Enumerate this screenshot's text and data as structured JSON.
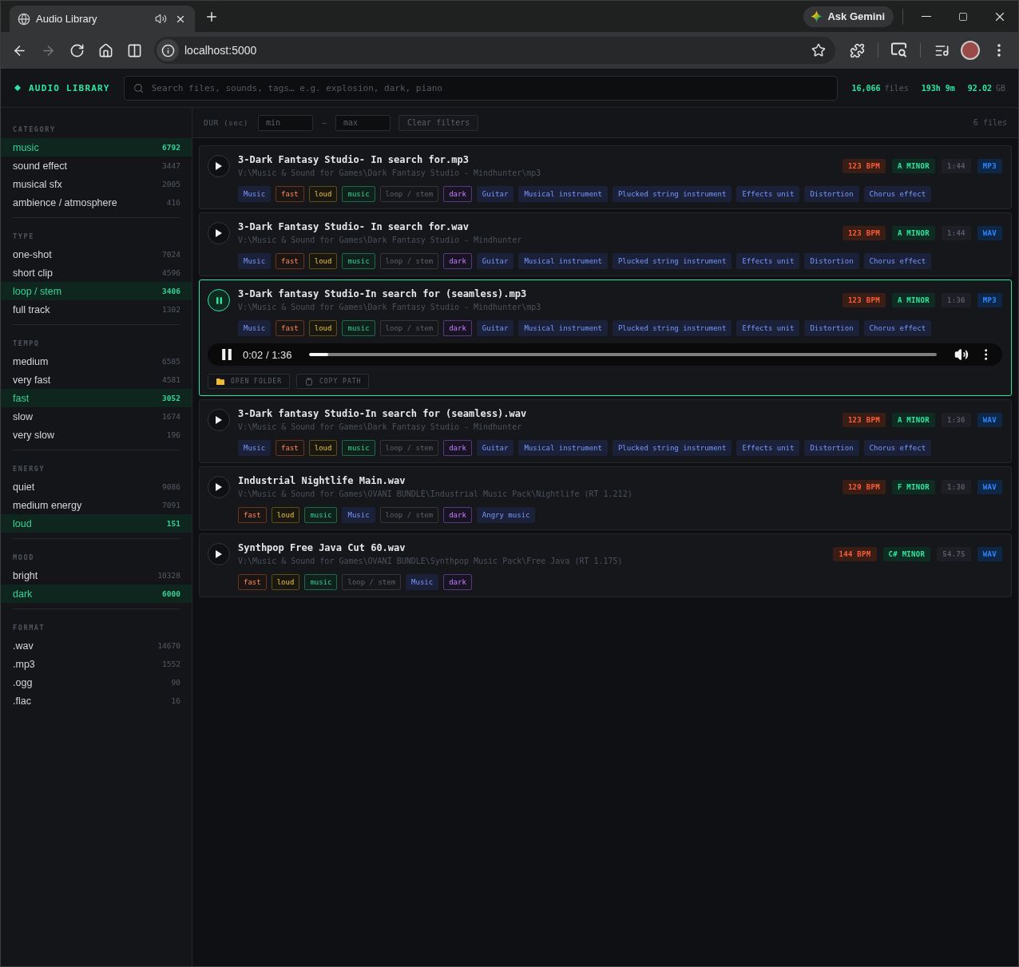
{
  "browser": {
    "tab_title": "Audio Library",
    "nav_buttons": [
      {
        "kind": "back",
        "disabled": false
      },
      {
        "kind": "forward",
        "disabled": true
      },
      {
        "kind": "reload",
        "disabled": false
      },
      {
        "kind": "home",
        "disabled": false
      },
      {
        "kind": "split",
        "disabled": false
      }
    ],
    "url": "localhost:5000",
    "gemini_button": "Ask Gemini"
  },
  "header": {
    "logo": "AUDIO LIBRARY",
    "search": {
      "placeholder": "Search files, sounds, tags… e.g. explosion, dark, piano"
    },
    "stats": [
      {
        "value": "16,066",
        "unit": "files"
      },
      {
        "value": "193h 9m"
      },
      {
        "value": "92.02",
        "unit": "GB"
      }
    ]
  },
  "filters": {
    "label": "DUR (sec)",
    "min": {
      "placeholder": "min"
    },
    "separator": "–",
    "max": {
      "placeholder": "max"
    },
    "clear_button": "Clear filters",
    "result_count": "6 files"
  },
  "sidebar": {
    "sections": [
      {
        "title": "CATEGORY",
        "items": [
          {
            "label": "music",
            "count": "6792",
            "selected": true
          },
          {
            "label": "sound effect",
            "count": "3447",
            "selected": false
          },
          {
            "label": "musical sfx",
            "count": "2005",
            "selected": false
          },
          {
            "label": "ambience / atmosphere",
            "count": "416",
            "selected": false
          }
        ]
      },
      {
        "title": "TYPE",
        "items": [
          {
            "label": "one-shot",
            "count": "7024",
            "selected": false
          },
          {
            "label": "short clip",
            "count": "4596",
            "selected": false
          },
          {
            "label": "loop / stem",
            "count": "3406",
            "selected": true
          },
          {
            "label": "full track",
            "count": "1302",
            "selected": false
          }
        ]
      },
      {
        "title": "TEMPO",
        "items": [
          {
            "label": "medium",
            "count": "6585",
            "selected": false
          },
          {
            "label": "very fast",
            "count": "4581",
            "selected": false
          },
          {
            "label": "fast",
            "count": "3052",
            "selected": true
          },
          {
            "label": "slow",
            "count": "1674",
            "selected": false
          },
          {
            "label": "very slow",
            "count": "196",
            "selected": false
          }
        ]
      },
      {
        "title": "ENERGY",
        "items": [
          {
            "label": "quiet",
            "count": "9086",
            "selected": false
          },
          {
            "label": "medium energy",
            "count": "7091",
            "selected": false
          },
          {
            "label": "loud",
            "count": "151",
            "selected": true
          }
        ]
      },
      {
        "title": "MOOD",
        "items": [
          {
            "label": "bright",
            "count": "10328",
            "selected": false
          },
          {
            "label": "dark",
            "count": "6000",
            "selected": true
          }
        ]
      },
      {
        "title": "FORMAT",
        "items": [
          {
            "label": ".wav",
            "count": "14670",
            "selected": false
          },
          {
            "label": ".mp3",
            "count": "1552",
            "selected": false
          },
          {
            "label": ".ogg",
            "count": "90",
            "selected": false
          },
          {
            "label": ".flac",
            "count": "16",
            "selected": false
          }
        ]
      }
    ]
  },
  "files": [
    {
      "title": "3-Dark Fantasy Studio- In search for.mp3",
      "path": "V:\\Music & Sound for Games\\Dark Fantasy Studio - Mindhunter\\mp3",
      "playing": false,
      "badges": [
        {
          "text": "123 BPM",
          "kind": "bpm"
        },
        {
          "text": "A MINOR",
          "kind": "key"
        },
        {
          "text": "1:44",
          "kind": "duration"
        },
        {
          "text": "MP3",
          "kind": "format"
        }
      ],
      "tags": [
        {
          "text": "Music",
          "kind": "label"
        },
        {
          "text": "fast",
          "kind": "tempo"
        },
        {
          "text": "loud",
          "kind": "energy"
        },
        {
          "text": "music",
          "kind": "category"
        },
        {
          "text": "loop / stem",
          "kind": "type"
        },
        {
          "text": "dark",
          "kind": "mood"
        },
        {
          "text": "Guitar",
          "kind": "label"
        },
        {
          "text": "Musical instrument",
          "kind": "label"
        },
        {
          "text": "Plucked string instrument",
          "kind": "label"
        },
        {
          "text": "Effects unit",
          "kind": "label"
        },
        {
          "text": "Distortion",
          "kind": "label"
        },
        {
          "text": "Chorus effect",
          "kind": "label"
        }
      ]
    },
    {
      "title": "3-Dark Fantasy Studio- In search for.wav",
      "path": "V:\\Music & Sound for Games\\Dark Fantasy Studio - Mindhunter",
      "playing": false,
      "badges": [
        {
          "text": "123 BPM",
          "kind": "bpm"
        },
        {
          "text": "A MINOR",
          "kind": "key"
        },
        {
          "text": "1:44",
          "kind": "duration"
        },
        {
          "text": "WAV",
          "kind": "format"
        }
      ],
      "tags": [
        {
          "text": "Music",
          "kind": "label"
        },
        {
          "text": "fast",
          "kind": "tempo"
        },
        {
          "text": "loud",
          "kind": "energy"
        },
        {
          "text": "music",
          "kind": "category"
        },
        {
          "text": "loop / stem",
          "kind": "type"
        },
        {
          "text": "dark",
          "kind": "mood"
        },
        {
          "text": "Guitar",
          "kind": "label"
        },
        {
          "text": "Musical instrument",
          "kind": "label"
        },
        {
          "text": "Plucked string instrument",
          "kind": "label"
        },
        {
          "text": "Effects unit",
          "kind": "label"
        },
        {
          "text": "Distortion",
          "kind": "label"
        },
        {
          "text": "Chorus effect",
          "kind": "label"
        }
      ]
    },
    {
      "title": "3-Dark fantasy Studio-In search for (seamless).mp3",
      "path": "V:\\Music & Sound for Games\\Dark Fantasy Studio - Mindhunter\\mp3",
      "playing": true,
      "badges": [
        {
          "text": "123 BPM",
          "kind": "bpm"
        },
        {
          "text": "A MINOR",
          "kind": "key"
        },
        {
          "text": "1:36",
          "kind": "duration"
        },
        {
          "text": "MP3",
          "kind": "format"
        }
      ],
      "tags": [
        {
          "text": "Music",
          "kind": "label"
        },
        {
          "text": "fast",
          "kind": "tempo"
        },
        {
          "text": "loud",
          "kind": "energy"
        },
        {
          "text": "music",
          "kind": "category"
        },
        {
          "text": "loop / stem",
          "kind": "type"
        },
        {
          "text": "dark",
          "kind": "mood"
        },
        {
          "text": "Guitar",
          "kind": "label"
        },
        {
          "text": "Musical instrument",
          "kind": "label"
        },
        {
          "text": "Plucked string instrument",
          "kind": "label"
        },
        {
          "text": "Effects unit",
          "kind": "label"
        },
        {
          "text": "Distortion",
          "kind": "label"
        },
        {
          "text": "Chorus effect",
          "kind": "label"
        }
      ],
      "player": {
        "time": "0:02 / 1:36",
        "level": 0.03
      },
      "actions": [
        {
          "text": "OPEN FOLDER",
          "kind": "folder"
        },
        {
          "text": "COPY PATH",
          "kind": "copy"
        }
      ]
    },
    {
      "title": "3-Dark fantasy Studio-In search for (seamless).wav",
      "path": "V:\\Music & Sound for Games\\Dark Fantasy Studio - Mindhunter",
      "playing": false,
      "badges": [
        {
          "text": "123 BPM",
          "kind": "bpm"
        },
        {
          "text": "A MINOR",
          "kind": "key"
        },
        {
          "text": "1:36",
          "kind": "duration"
        },
        {
          "text": "WAV",
          "kind": "format"
        }
      ],
      "tags": [
        {
          "text": "Music",
          "kind": "label"
        },
        {
          "text": "fast",
          "kind": "tempo"
        },
        {
          "text": "loud",
          "kind": "energy"
        },
        {
          "text": "music",
          "kind": "category"
        },
        {
          "text": "loop / stem",
          "kind": "type"
        },
        {
          "text": "dark",
          "kind": "mood"
        },
        {
          "text": "Guitar",
          "kind": "label"
        },
        {
          "text": "Musical instrument",
          "kind": "label"
        },
        {
          "text": "Plucked string instrument",
          "kind": "label"
        },
        {
          "text": "Effects unit",
          "kind": "label"
        },
        {
          "text": "Distortion",
          "kind": "label"
        },
        {
          "text": "Chorus effect",
          "kind": "label"
        }
      ]
    },
    {
      "title": "Industrial Nightlife Main.wav",
      "path": "V:\\Music & Sound for Games\\OVANI BUNDLE\\Industrial Music Pack\\Nightlife (RT 1.212)",
      "playing": false,
      "badges": [
        {
          "text": "129 BPM",
          "kind": "bpm"
        },
        {
          "text": "F MINOR",
          "kind": "key"
        },
        {
          "text": "1:30",
          "kind": "duration"
        },
        {
          "text": "WAV",
          "kind": "format"
        }
      ],
      "tags": [
        {
          "text": "fast",
          "kind": "tempo"
        },
        {
          "text": "loud",
          "kind": "energy"
        },
        {
          "text": "music",
          "kind": "category"
        },
        {
          "text": "Music",
          "kind": "label"
        },
        {
          "text": "loop / stem",
          "kind": "type"
        },
        {
          "text": "dark",
          "kind": "mood"
        },
        {
          "text": "Angry music",
          "kind": "label"
        }
      ]
    },
    {
      "title": "Synthpop Free Java Cut 60.wav",
      "path": "V:\\Music & Sound for Games\\OVANI BUNDLE\\Synthpop Music Pack\\Free Java (RT 1.175)",
      "playing": false,
      "badges": [
        {
          "text": "144 BPM",
          "kind": "bpm"
        },
        {
          "text": "C# MINOR",
          "kind": "key"
        },
        {
          "text": "54.7S",
          "kind": "duration"
        },
        {
          "text": "WAV",
          "kind": "format"
        }
      ],
      "tags": [
        {
          "text": "fast",
          "kind": "tempo"
        },
        {
          "text": "loud",
          "kind": "energy"
        },
        {
          "text": "music",
          "kind": "category"
        },
        {
          "text": "loop / stem",
          "kind": "type"
        },
        {
          "text": "Music",
          "kind": "label"
        },
        {
          "text": "dark",
          "kind": "mood"
        }
      ]
    }
  ]
}
